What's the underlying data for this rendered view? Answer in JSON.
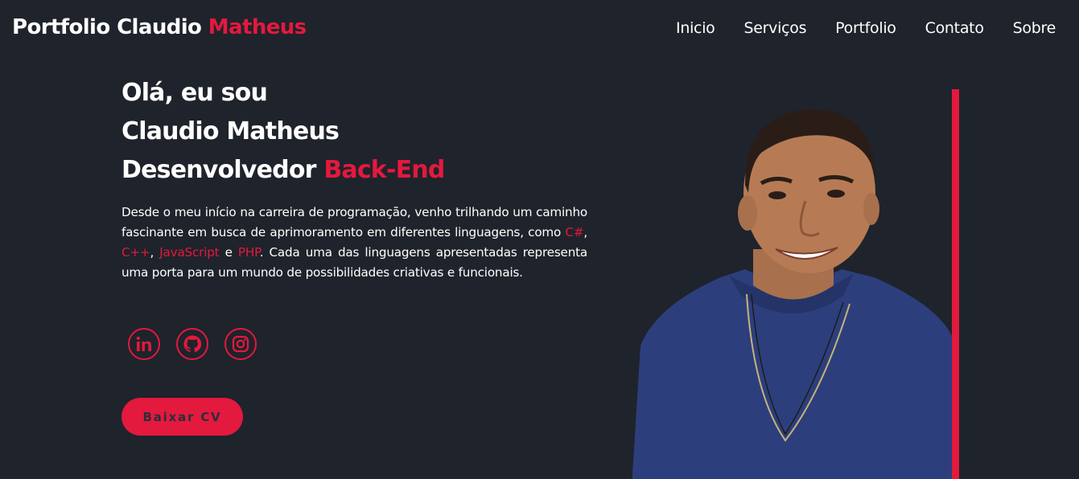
{
  "header": {
    "logo_main": "Portfolio Claudio",
    "logo_accent": "Matheus",
    "nav": [
      "Inicio",
      "Serviços",
      "Portfolio",
      "Contato",
      "Sobre"
    ]
  },
  "hero": {
    "line1": "Olá, eu sou",
    "line2": "Claudio Matheus",
    "line3_main": "Desenvolvedor",
    "line3_accent": "Back-End",
    "desc_part1": "Desde o meu início na carreira de programação, venho trilhando um caminho fascinante em busca de aprimoramento em diferentes linguagens, como",
    "lang1": "C#",
    "sep1": ",",
    "lang2": "C++",
    "sep2": ",",
    "lang3": "JavaScript",
    "sep3": "e",
    "lang4": "PHP",
    "desc_part2": ". Cada uma das linguagens apresentadas representa uma porta para um mundo de possibilidades criativas e funcionais.",
    "socials": [
      "linkedin-icon",
      "github-icon",
      "instagram-icon"
    ],
    "cv_button": "Baixar CV"
  },
  "colors": {
    "background": "#1f232b",
    "accent": "#e3193e",
    "text": "#ffffff"
  }
}
